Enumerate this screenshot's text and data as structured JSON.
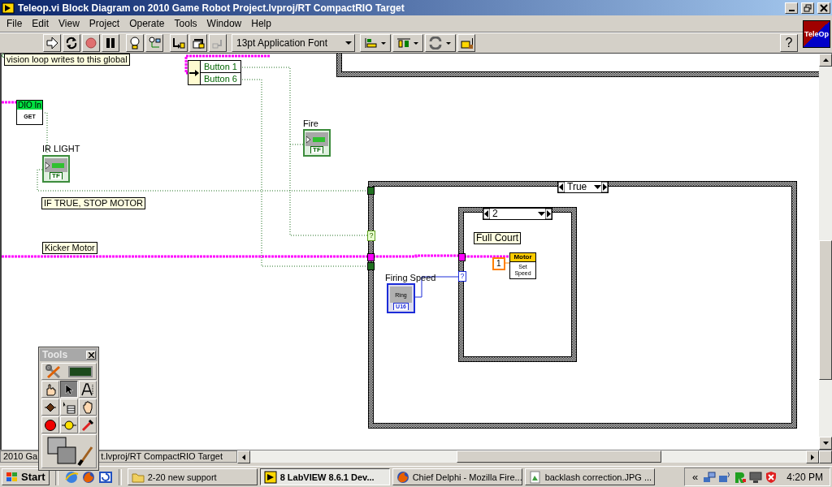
{
  "window": {
    "title": "Teleop.vi Block Diagram on 2010 Game Robot Project.lvproj/RT CompactRIO Target"
  },
  "menu": [
    {
      "label": "File"
    },
    {
      "label": "Edit"
    },
    {
      "label": "View"
    },
    {
      "label": "Project"
    },
    {
      "label": "Operate"
    },
    {
      "label": "Tools"
    },
    {
      "label": "Window"
    },
    {
      "label": "Help"
    }
  ],
  "toolbar": {
    "font": "13pt Application Font",
    "help": "?"
  },
  "vi_icon": {
    "text": "TeleOp"
  },
  "diagram": {
    "comments": [
      {
        "text": "vision loop writes to this global"
      },
      {
        "text": "IF TRUE, STOP MOTOR"
      },
      {
        "text": "Kicker Motor"
      },
      {
        "text": "Full Court"
      }
    ],
    "global_variable": {
      "items": [
        "Button 1",
        "Button 6"
      ]
    },
    "dio_node": {
      "header": "DIO In",
      "function": "GET"
    },
    "indicators": [
      {
        "label": "IR LIGHT",
        "type": "TF"
      },
      {
        "label": "Fire",
        "type": "TF"
      }
    ],
    "ring_control": {
      "label": "Firing Speed",
      "text": "Ring",
      "type": "U16"
    },
    "case_structures": [
      {
        "selector": "True",
        "terminal": "?"
      },
      {
        "selector": "2",
        "terminal": "?"
      }
    ],
    "constant": "1",
    "motor_node": {
      "header": "Motor",
      "function": "Set Speed"
    }
  },
  "tools_palette": {
    "title": "Tools",
    "tools": [
      {
        "kind": "automatic",
        "selected": false
      },
      {
        "kind": "operate",
        "selected": false
      },
      {
        "kind": "position",
        "selected": true
      },
      {
        "kind": "text",
        "selected": false
      },
      {
        "kind": "wiring",
        "selected": false
      },
      {
        "kind": "shortcut",
        "selected": false
      },
      {
        "kind": "scroll",
        "selected": false
      },
      {
        "kind": "breakpoint",
        "selected": false
      },
      {
        "kind": "probe",
        "selected": false
      },
      {
        "kind": "copy_color",
        "selected": false
      },
      {
        "kind": "coloring",
        "selected": false
      }
    ]
  },
  "status_bar": {
    "path_start": "2010 Ga",
    "path_end": "t.lvproj/RT CompactRIO Target"
  },
  "taskbar": {
    "start": "Start",
    "tasks": [
      {
        "kind": "folder",
        "label": "2-20 new support",
        "selected": false
      },
      {
        "kind": "labview",
        "label": "8 LabVIEW 8.6.1 Dev...",
        "selected": true
      },
      {
        "kind": "firefox",
        "label": "Chief Delphi - Mozilla Fire...",
        "selected": false
      },
      {
        "kind": "image",
        "label": "backlash correction.JPG ...",
        "selected": false
      }
    ],
    "tray_expand": "«",
    "clock": "4:20 PM"
  }
}
